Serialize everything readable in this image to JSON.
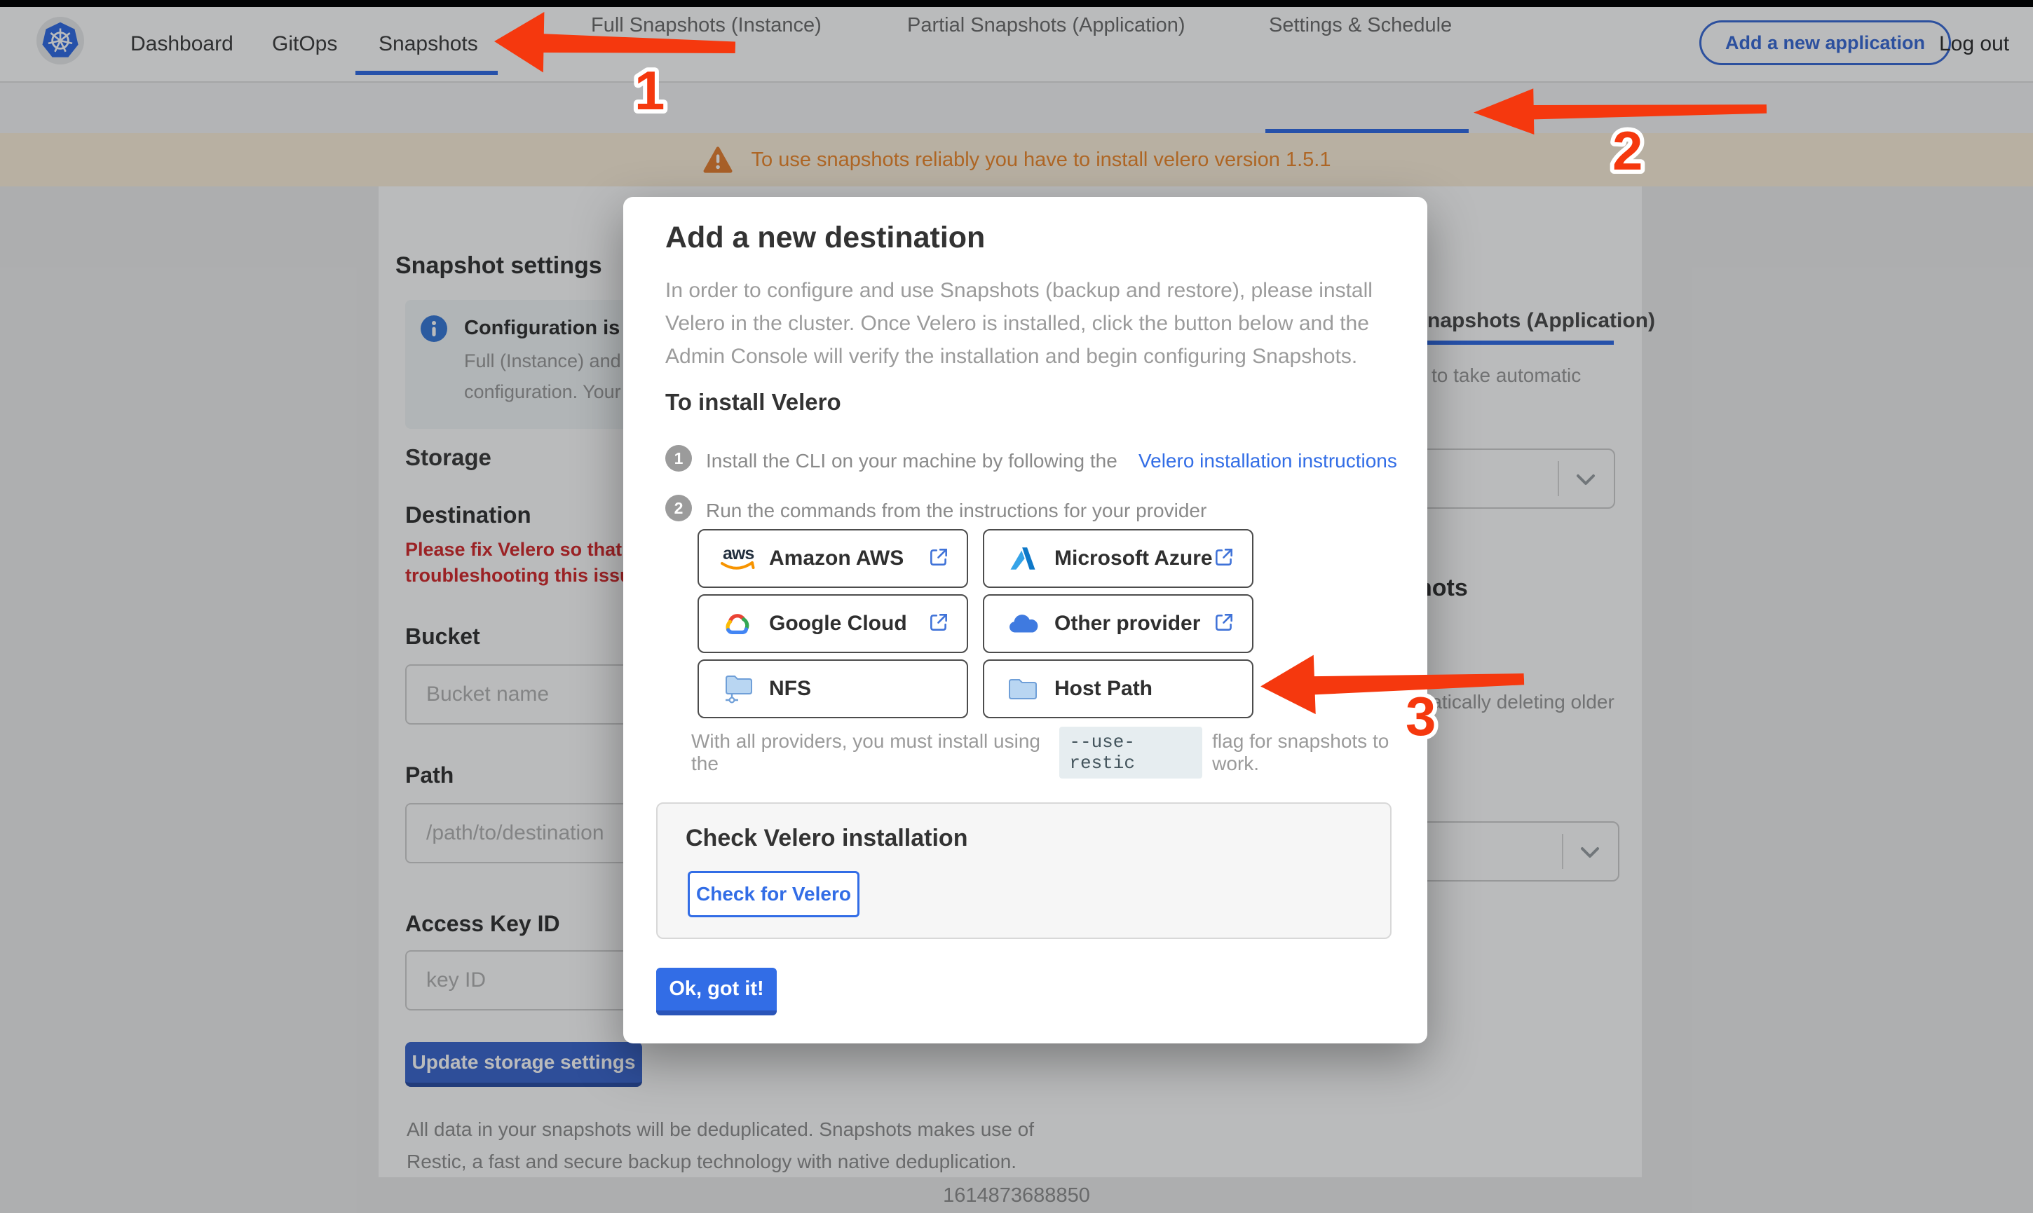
{
  "topbar": {
    "nav_dashboard": "Dashboard",
    "nav_gitops": "GitOps",
    "nav_snapshots": "Snapshots",
    "add_application": "Add a new application",
    "log_out": "Log out"
  },
  "subnav": {
    "tab_full": "Full Snapshots (Instance)",
    "tab_partial": "Partial Snapshots (Application)",
    "tab_settings": "Settings & Schedule"
  },
  "banner": {
    "message": "To use snapshots reliably you have to install velero version 1.5.1"
  },
  "settings_page": {
    "section_title": "Snapshot settings",
    "info_title_fragment": "Configuration is sh",
    "info_line1_fragment": "Full (Instance) and Parti",
    "info_line2_fragment": "configuration. Your stor",
    "storage_heading": "Storage",
    "destination_heading": "Destination",
    "error_line1_fragment": "Please fix Velero so that th",
    "error_line2_fragment": "troubleshooting this issue",
    "bucket_label": "Bucket",
    "bucket_placeholder": "Bucket name",
    "path_label": "Path",
    "path_placeholder": "/path/to/destination",
    "access_key_label": "Access Key ID",
    "access_key_placeholder": "key ID",
    "update_button": "Update storage settings",
    "footnote_line1": "All data in your snapshots will be deduplicated. Snapshots makes use of",
    "footnote_line2": "Restic, a fast and secure backup technology with native deduplication."
  },
  "schedule_panel": {
    "tab_fragment": "napshots (Application)",
    "auto_fragment": "to take automatic",
    "heading_fragment": "hots",
    "retention_fragment": "matically deleting older"
  },
  "modal": {
    "title": "Add a new destination",
    "intro_line1": "In order to configure and use Snapshots (backup and restore), please install",
    "intro_line2": "Velero in the cluster. Once Velero is installed, click the button below and the",
    "intro_line3": "Admin Console will verify the installation and begin configuring Snapshots.",
    "install_heading": "To install Velero",
    "step1_number": "1",
    "step1_text": "Install the CLI on your machine by following the",
    "step1_link": "Velero installation instructions",
    "step2_number": "2",
    "step2_text": "Run the commands from the instructions for your provider",
    "providers": [
      {
        "label": "Amazon AWS"
      },
      {
        "label": "Microsoft Azure"
      },
      {
        "label": "Google Cloud"
      },
      {
        "label": "Other provider"
      },
      {
        "label": "NFS"
      },
      {
        "label": "Host Path"
      }
    ],
    "restic_prefix": "With all providers, you must install using the",
    "restic_code": "--use-restic",
    "restic_suffix": "flag for snapshots to work.",
    "check_heading": "Check Velero installation",
    "check_button": "Check for Velero",
    "ok_button": "Ok, got it!"
  },
  "footer": {
    "timestamp": "1614873688850"
  },
  "annotations": {
    "n1": "1",
    "n2": "2",
    "n3": "3"
  },
  "colors": {
    "accent_blue": "#326de6",
    "arrow_red": "#f5380e",
    "warning_orange": "#ef8a2e",
    "error_red": "#d42b2e"
  }
}
